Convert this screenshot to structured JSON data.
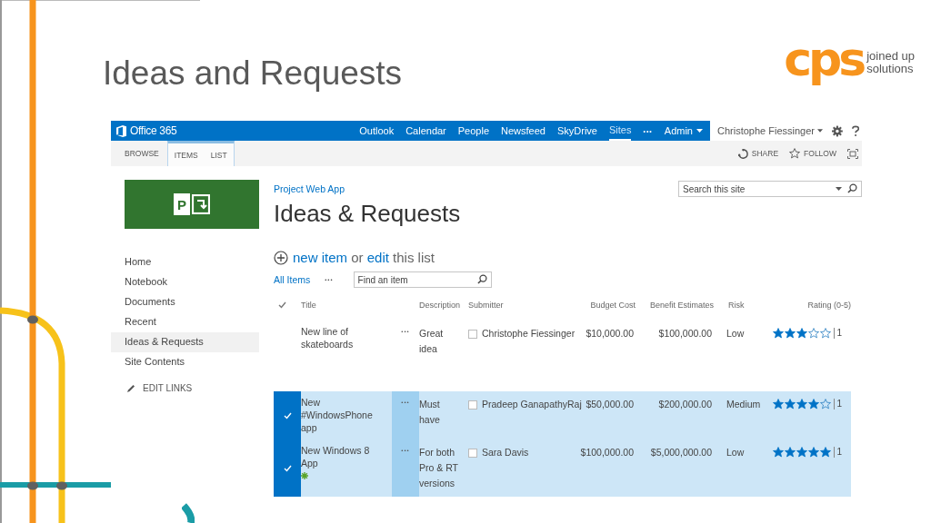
{
  "slide": {
    "title": "Ideas and Requests"
  },
  "brand_logo": {
    "mark": "cps",
    "tagline": [
      "joined up",
      "solutions"
    ]
  },
  "suite_bar": {
    "product": "Office 365",
    "links": [
      {
        "label": "Outlook",
        "selected": false
      },
      {
        "label": "Calendar",
        "selected": false
      },
      {
        "label": "People",
        "selected": false
      },
      {
        "label": "Newsfeed",
        "selected": false
      },
      {
        "label": "SkyDrive",
        "selected": false
      },
      {
        "label": "Sites",
        "selected": true
      }
    ],
    "more": "•••",
    "admin": "Admin",
    "user": "Christophe Fiessinger"
  },
  "ribbon": {
    "tabs": [
      {
        "label": "BROWSE",
        "contextual": false
      },
      {
        "label": "ITEMS",
        "contextual": true
      },
      {
        "label": "LIST",
        "contextual": true
      }
    ],
    "share": "SHARE",
    "follow": "FOLLOW"
  },
  "site": {
    "logo_letter": "P",
    "breadcrumb": "Project Web App",
    "title": "Ideas & Requests",
    "search": {
      "placeholder": "Search this site"
    }
  },
  "quick_launch": {
    "items": [
      {
        "label": "Home",
        "selected": false
      },
      {
        "label": "Notebook",
        "selected": false
      },
      {
        "label": "Documents",
        "selected": false
      },
      {
        "label": "Recent",
        "selected": false
      },
      {
        "label": "Ideas & Requests",
        "selected": true
      },
      {
        "label": "Site Contents",
        "selected": false
      }
    ],
    "edit_links": "EDIT LINKS"
  },
  "list": {
    "command": {
      "new_item": "new item",
      "middle": "or",
      "edit": "edit",
      "tail": "this list"
    },
    "view": "All Items",
    "view_more": "•••",
    "find": {
      "placeholder": "Find an item"
    },
    "columns": [
      "Title",
      "Description",
      "Submitter",
      "Budget Cost",
      "Benefit Estimates",
      "Risk",
      "Rating (0-5)"
    ],
    "rows": [
      {
        "selected": false,
        "title": "New line of skateboards",
        "is_new": false,
        "menu": "•••",
        "description": "Great idea",
        "submitter": "Christophe Fiessinger",
        "budget_cost": "$10,000.00",
        "benefit": "$100,000.00",
        "risk": "Low",
        "stars": 3,
        "rating_count": "1"
      },
      {
        "selected": true,
        "title": "New #WindowsPhone app",
        "is_new": false,
        "menu": "•••",
        "description": "Must have",
        "submitter": "Pradeep GanapathyRaj",
        "budget_cost": "$50,000.00",
        "benefit": "$200,000.00",
        "risk": "Medium",
        "stars": 4,
        "rating_count": "1"
      },
      {
        "selected": true,
        "title": "New Windows 8 App",
        "is_new": true,
        "menu": "•••",
        "description": "For both Pro & RT versions",
        "submitter": "Sara Davis",
        "budget_cost": "$100,000.00",
        "benefit": "$5,000,000.00",
        "risk": "Low",
        "stars": 5,
        "rating_count": "1"
      }
    ]
  }
}
